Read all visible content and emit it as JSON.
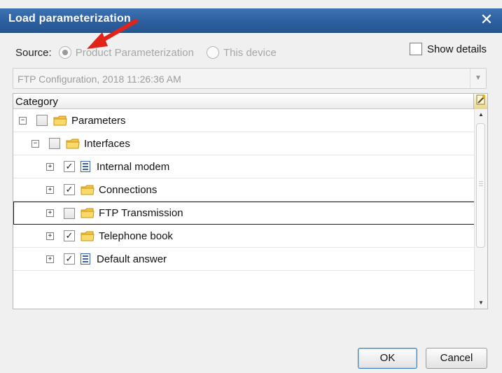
{
  "window": {
    "title": "Load parameterization",
    "close_glyph": "✕"
  },
  "source": {
    "label": "Source:",
    "options": [
      {
        "label": "Product Parameterization",
        "selected": true,
        "enabled": false
      },
      {
        "label": "This device",
        "selected": false,
        "enabled": false
      }
    ]
  },
  "show_details": {
    "label": "Show details",
    "checked": false
  },
  "configuration_select": {
    "value": "FTP Configuration, 2018 11:26:36 AM"
  },
  "tree": {
    "column_header": "Category",
    "rows": [
      {
        "label": "Parameters",
        "level": 0,
        "expander": "−",
        "checked": false,
        "icon": "folder-icon"
      },
      {
        "label": "Interfaces",
        "level": 1,
        "expander": "−",
        "checked": false,
        "icon": "folder-icon"
      },
      {
        "label": "Internal modem",
        "level": 2,
        "expander": "+",
        "checked": true,
        "icon": "list-icon"
      },
      {
        "label": "Connections",
        "level": 2,
        "expander": "+",
        "checked": true,
        "icon": "folder-icon"
      },
      {
        "label": "FTP Transmission",
        "level": 2,
        "expander": "+",
        "checked": false,
        "icon": "folder-icon",
        "selected": true
      },
      {
        "label": "Telephone book",
        "level": 2,
        "expander": "+",
        "checked": true,
        "icon": "folder-icon"
      },
      {
        "label": "Default answer",
        "level": 2,
        "expander": "+",
        "checked": true,
        "icon": "list-icon"
      }
    ]
  },
  "buttons": {
    "ok": "OK",
    "cancel": "Cancel"
  },
  "colors": {
    "titlebar": "#2c5e9e",
    "folder": "#f4c542",
    "list_icon": "#3b63b4",
    "annotation_arrow": "#e2231a"
  }
}
